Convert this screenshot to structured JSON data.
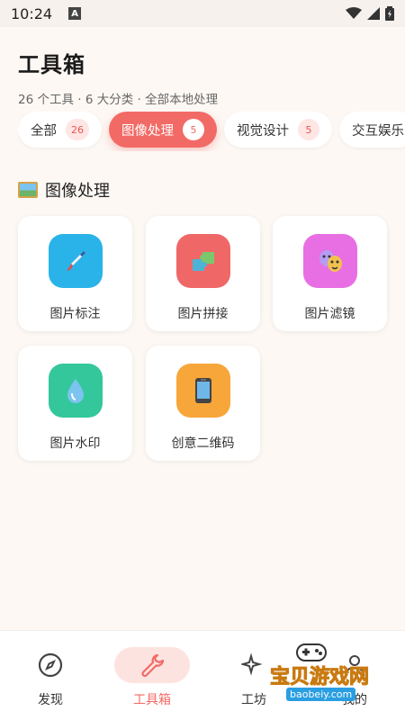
{
  "status_bar": {
    "time": "10:24",
    "notif": "A"
  },
  "header": {
    "title": "工具箱",
    "subtitle": "26 个工具 · 6 大分类 · 全部本地处理"
  },
  "chips": [
    {
      "label": "全部",
      "count": "26"
    },
    {
      "label": "图像处理",
      "count": "5"
    },
    {
      "label": "视觉设计",
      "count": "5"
    },
    {
      "label": "交互娱乐",
      "count": ""
    }
  ],
  "section": {
    "title": "图像处理",
    "icon": "picture-icon"
  },
  "tools": [
    {
      "label": "图片标注",
      "icon": "paintbrush-icon",
      "color": "#2ab3e8"
    },
    {
      "label": "图片拼接",
      "icon": "puzzle-icon",
      "color": "#f06767"
    },
    {
      "label": "图片滤镜",
      "icon": "masks-icon",
      "color": "#e86fe3"
    },
    {
      "label": "图片水印",
      "icon": "droplet-icon",
      "color": "#34c79b"
    },
    {
      "label": "创意二维码",
      "icon": "phone-icon",
      "color": "#f7a63a"
    }
  ],
  "nav": [
    {
      "label": "发现",
      "icon": "compass-icon"
    },
    {
      "label": "工具箱",
      "icon": "wrench-icon"
    },
    {
      "label": "工坊",
      "icon": "sparkles-icon"
    },
    {
      "label": "我的",
      "icon": "user-icon"
    }
  ],
  "watermark": {
    "text": "宝贝游戏网",
    "url": "baobeiy.com"
  },
  "colors": {
    "accent": "#f26a66",
    "background": "#fdf8f4"
  }
}
